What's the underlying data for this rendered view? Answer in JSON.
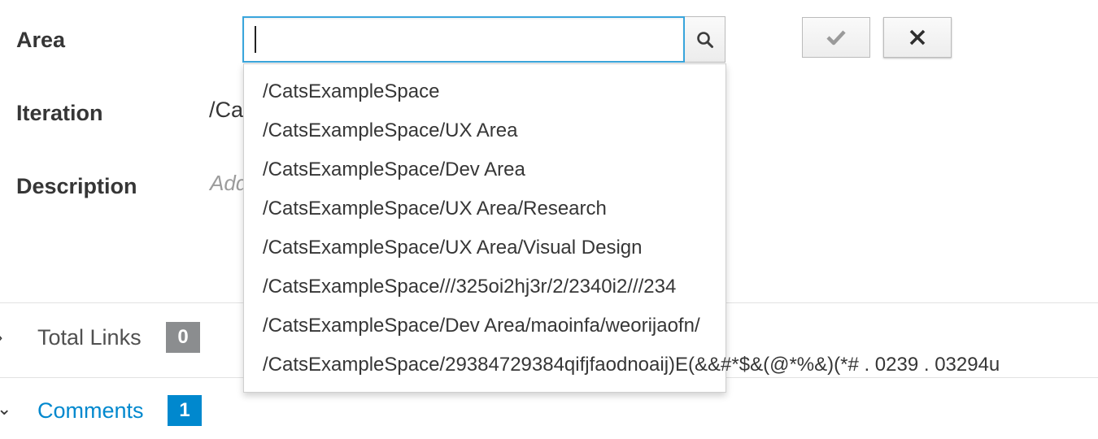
{
  "fields": {
    "area_label": "Area",
    "iteration_label": "Iteration",
    "iteration_value_partial": "/Ca",
    "description_label": "Description",
    "description_placeholder_partial": "Add"
  },
  "search": {
    "value": "",
    "placeholder": "",
    "icon": "search-icon"
  },
  "actions": {
    "save_icon": "checkmark-icon",
    "cancel_icon": "close-icon"
  },
  "dropdown": {
    "items": [
      "/CatsExampleSpace",
      "/CatsExampleSpace/UX Area",
      "/CatsExampleSpace/Dev Area",
      "/CatsExampleSpace/UX Area/Research",
      "/CatsExampleSpace/UX Area/Visual Design",
      "/CatsExampleSpace///325oi2hj3r/2/2340i2///234",
      "/CatsExampleSpace/Dev Area/maoinfa/weorijaofn/",
      "/CatsExampleSpace/29384729384qifjfaodnoaij)E(&&#*$&(@*%&)(*# . 0239 . 03294u"
    ]
  },
  "sections": {
    "total_links": {
      "label": "Total Links",
      "count": "0",
      "toggle": "›"
    },
    "comments": {
      "label": "Comments",
      "count": "1",
      "toggle": "⌄"
    }
  },
  "colors": {
    "accent": "#39a5dc",
    "link": "#0088ce",
    "badge_gray": "#8b8d8f",
    "badge_blue": "#0088ce",
    "text": "#363636"
  }
}
